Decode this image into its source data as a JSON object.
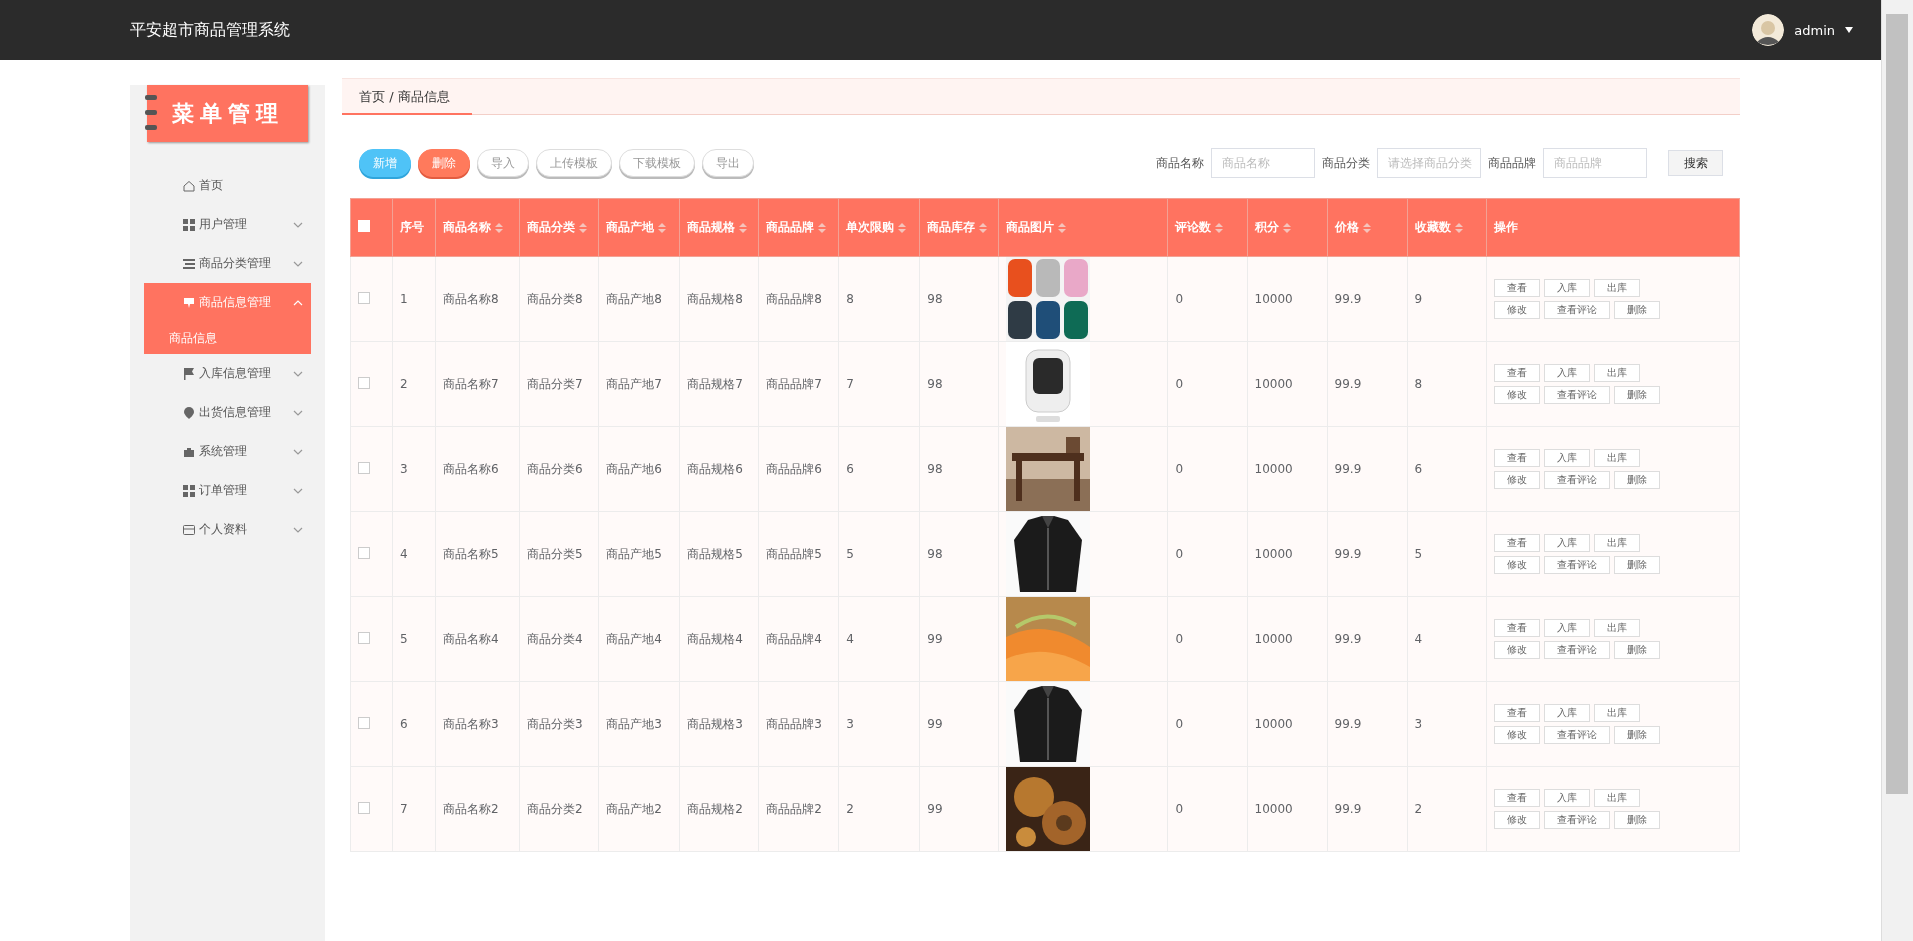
{
  "header": {
    "title": "平安超市商品管理系统",
    "user": "admin"
  },
  "sidebar": {
    "logo": "菜单管理",
    "items": [
      {
        "label": "首页",
        "kind": "link",
        "expanded": false
      },
      {
        "label": "用户管理",
        "kind": "group",
        "expanded": false
      },
      {
        "label": "商品分类管理",
        "kind": "group",
        "expanded": false
      },
      {
        "label": "商品信息管理",
        "kind": "group",
        "expanded": true,
        "children": [
          {
            "label": "商品信息",
            "selected": true
          }
        ]
      },
      {
        "label": "入库信息管理",
        "kind": "group",
        "expanded": false
      },
      {
        "label": "出货信息管理",
        "kind": "group",
        "expanded": false
      },
      {
        "label": "系统管理",
        "kind": "group",
        "expanded": false
      },
      {
        "label": "订单管理",
        "kind": "group",
        "expanded": false
      },
      {
        "label": "个人资料",
        "kind": "group",
        "expanded": false
      }
    ]
  },
  "breadcrumb": "首页 / 商品信息",
  "toolbar": {
    "buttons": [
      {
        "label": "新增",
        "kind": "primary"
      },
      {
        "label": "删除",
        "kind": "danger"
      },
      {
        "label": "导入",
        "kind": "plain"
      },
      {
        "label": "上传模板",
        "kind": "plain"
      },
      {
        "label": "下载模板",
        "kind": "plain"
      },
      {
        "label": "导出",
        "kind": "plain"
      }
    ],
    "filters": [
      {
        "label": "商品名称",
        "placeholder": "商品名称",
        "kind": "input"
      },
      {
        "label": "商品分类",
        "placeholder": "请选择商品分类",
        "kind": "select"
      },
      {
        "label": "商品品牌",
        "placeholder": "商品品牌",
        "kind": "input"
      }
    ],
    "search": "搜索"
  },
  "table": {
    "select_all": {
      "checked": false
    },
    "columns": [
      {
        "label": "序号",
        "sortable": false
      },
      {
        "label": "商品名称",
        "sortable": true
      },
      {
        "label": "商品分类",
        "sortable": true
      },
      {
        "label": "商品产地",
        "sortable": true
      },
      {
        "label": "商品规格",
        "sortable": true
      },
      {
        "label": "商品品牌",
        "sortable": true
      },
      {
        "label": "单次限购",
        "sortable": true
      },
      {
        "label": "商品库存",
        "sortable": true
      },
      {
        "label": "商品图片",
        "sortable": true
      },
      {
        "label": "评论数",
        "sortable": true
      },
      {
        "label": "积分",
        "sortable": true
      },
      {
        "label": "价格",
        "sortable": true
      },
      {
        "label": "收藏数",
        "sortable": true
      },
      {
        "label": "操作",
        "sortable": false
      }
    ],
    "rows": [
      {
        "checked": false,
        "cells": [
          "1",
          "商品名称8",
          "商品分类8",
          "商品产地8",
          "商品规格8",
          "商品品牌8",
          "8",
          "98"
        ],
        "after": [
          "0",
          "10000",
          "99.9",
          "9"
        ],
        "actions": [
          "查看",
          "入库",
          "出库",
          "修改",
          "查看评论",
          "删除"
        ]
      },
      {
        "checked": false,
        "cells": [
          "2",
          "商品名称7",
          "商品分类7",
          "商品产地7",
          "商品规格7",
          "商品品牌7",
          "7",
          "98"
        ],
        "after": [
          "0",
          "10000",
          "99.9",
          "8"
        ],
        "actions": [
          "查看",
          "入库",
          "出库",
          "修改",
          "查看评论",
          "删除"
        ]
      },
      {
        "checked": false,
        "cells": [
          "3",
          "商品名称6",
          "商品分类6",
          "商品产地6",
          "商品规格6",
          "商品品牌6",
          "6",
          "98"
        ],
        "after": [
          "0",
          "10000",
          "99.9",
          "6"
        ],
        "actions": [
          "查看",
          "入库",
          "出库",
          "修改",
          "查看评论",
          "删除"
        ]
      },
      {
        "checked": false,
        "cells": [
          "4",
          "商品名称5",
          "商品分类5",
          "商品产地5",
          "商品规格5",
          "商品品牌5",
          "5",
          "98"
        ],
        "after": [
          "0",
          "10000",
          "99.9",
          "5"
        ],
        "actions": [
          "查看",
          "入库",
          "出库",
          "修改",
          "查看评论",
          "删除"
        ]
      },
      {
        "checked": false,
        "cells": [
          "5",
          "商品名称4",
          "商品分类4",
          "商品产地4",
          "商品规格4",
          "商品品牌4",
          "4",
          "99"
        ],
        "after": [
          "0",
          "10000",
          "99.9",
          "4"
        ],
        "actions": [
          "查看",
          "入库",
          "出库",
          "修改",
          "查看评论",
          "删除"
        ]
      },
      {
        "checked": false,
        "cells": [
          "6",
          "商品名称3",
          "商品分类3",
          "商品产地3",
          "商品规格3",
          "商品品牌3",
          "3",
          "99"
        ],
        "after": [
          "0",
          "10000",
          "99.9",
          "3"
        ],
        "actions": [
          "查看",
          "入库",
          "出库",
          "修改",
          "查看评论",
          "删除"
        ]
      },
      {
        "checked": false,
        "cells": [
          "7",
          "商品名称2",
          "商品分类2",
          "商品产地2",
          "商品规格2",
          "商品品牌2",
          "2",
          "99"
        ],
        "after": [
          "0",
          "10000",
          "99.9",
          "2"
        ],
        "actions": [
          "查看",
          "入库",
          "出库",
          "修改",
          "查看评论",
          "删除"
        ]
      }
    ]
  }
}
